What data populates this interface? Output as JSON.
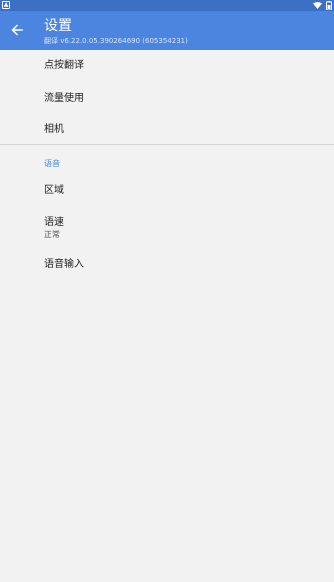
{
  "colors": {
    "status_bar": "#3b70c5",
    "app_bar": "#4b85e0",
    "background": "#f2f2f2",
    "accent": "#4b85e0"
  },
  "app_bar": {
    "title": "设置",
    "subtitle": "翻译 v6.22.0.05.390264690 (605354231)",
    "back_icon": "arrow-left-icon"
  },
  "status_bar": {
    "left_icon": "notification-icon",
    "right_icons": [
      "wifi-icon",
      "battery-icon"
    ]
  },
  "settings": {
    "items": [
      {
        "title": "点按翻译"
      },
      {
        "title": "流量使用"
      },
      {
        "title": "相机"
      }
    ],
    "speech_section": {
      "header": "语音",
      "items": [
        {
          "title": "区域",
          "summary": ""
        },
        {
          "title": "语速",
          "summary": "正常"
        },
        {
          "title": "语音输入",
          "summary": ""
        }
      ]
    }
  }
}
